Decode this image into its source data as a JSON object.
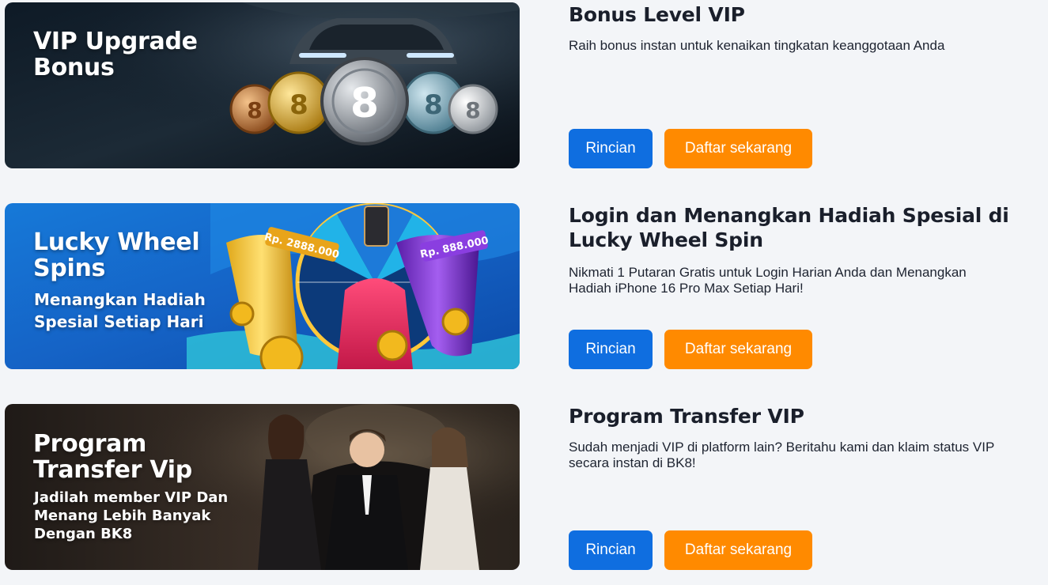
{
  "promotions": [
    {
      "banner": {
        "title": "VIP Upgrade Bonus",
        "subtitle": ""
      },
      "title": "Bonus Level VIP",
      "description": "Raih bonus instan untuk kenaikan tingkatan keanggotaan Anda",
      "detail_label": "Rincian",
      "register_label": "Daftar sekarang"
    },
    {
      "banner": {
        "title": "Lucky Wheel Spins",
        "subtitle": "Menangkan Hadiah Spesial Setiap Hari",
        "prize_left": "Rp. 2888.000",
        "prize_right": "Rp. 888.000"
      },
      "title": "Login dan Menangkan Hadiah Spesial di Lucky Wheel Spin",
      "description": "Nikmati 1 Putaran Gratis untuk Login Harian Anda dan Menangkan Hadiah iPhone 16 Pro Max Setiap Hari!",
      "detail_label": "Rincian",
      "register_label": "Daftar sekarang"
    },
    {
      "banner": {
        "title": "Program Transfer Vip",
        "subtitle": "Jadilah member VIP Dan Menang Lebih Banyak Dengan BK8"
      },
      "title": "Program Transfer VIP",
      "description": "Sudah menjadi VIP di platform lain? Beritahu kami dan klaim status VIP secara instan di BK8!",
      "detail_label": "Rincian",
      "register_label": "Daftar sekarang"
    }
  ],
  "colors": {
    "page_background": "#f3f5f8",
    "detail_button": "#0f6ee0",
    "register_button": "#ff8a00"
  }
}
